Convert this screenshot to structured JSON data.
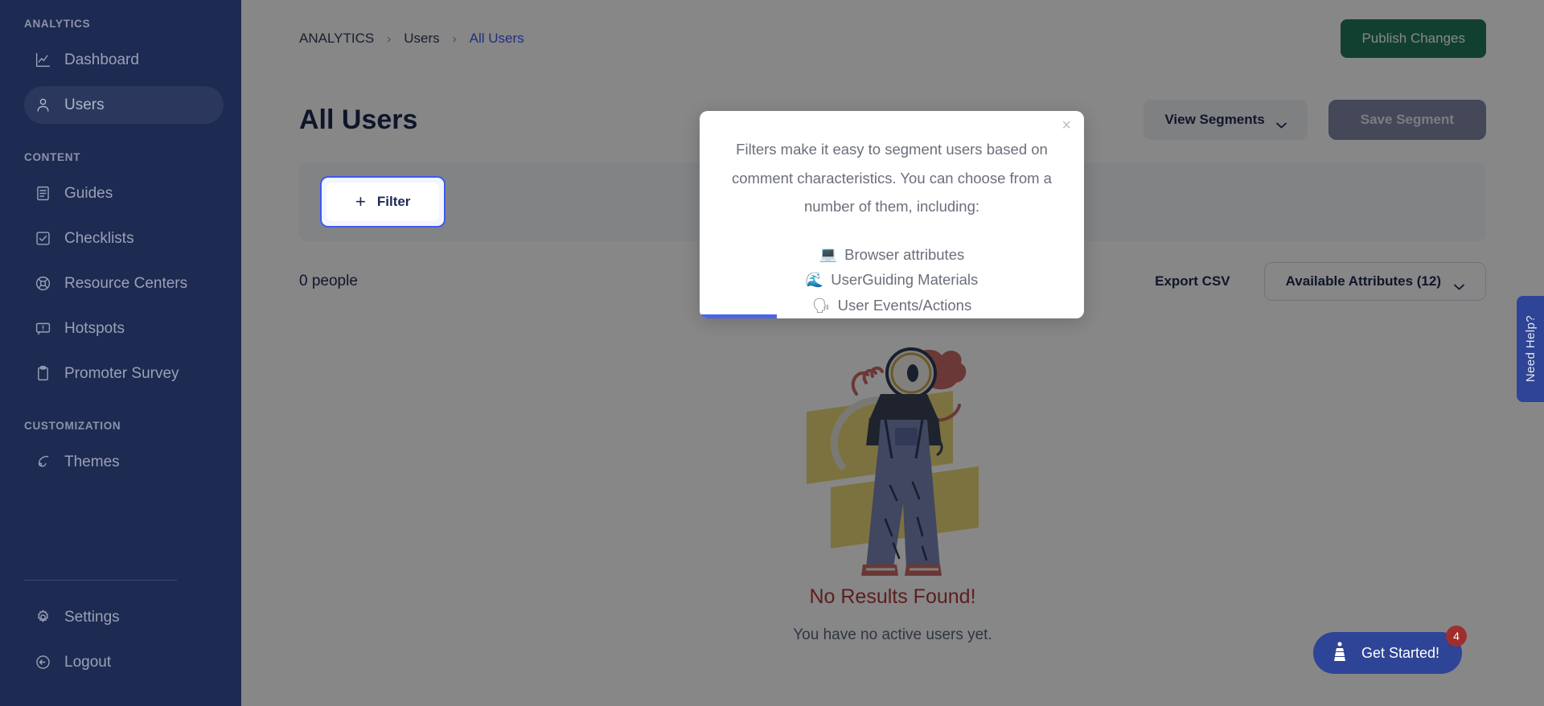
{
  "sidebar": {
    "sections": [
      {
        "title": "ANALYTICS",
        "items": [
          {
            "label": "Dashboard",
            "icon": "chart-line-icon",
            "active": false
          },
          {
            "label": "Users",
            "icon": "user-icon",
            "active": true
          }
        ]
      },
      {
        "title": "CONTENT",
        "items": [
          {
            "label": "Guides",
            "icon": "document-icon",
            "active": false
          },
          {
            "label": "Checklists",
            "icon": "checkbox-icon",
            "active": false
          },
          {
            "label": "Resource Centers",
            "icon": "lifebuoy-icon",
            "active": false
          },
          {
            "label": "Hotspots",
            "icon": "hotspot-icon",
            "active": false
          },
          {
            "label": "Promoter Survey",
            "icon": "clipboard-icon",
            "active": false
          }
        ]
      },
      {
        "title": "CUSTOMIZATION",
        "items": [
          {
            "label": "Themes",
            "icon": "paint-icon",
            "active": false
          }
        ]
      }
    ],
    "bottom": [
      {
        "label": "Settings",
        "icon": "gear-icon"
      },
      {
        "label": "Logout",
        "icon": "logout-icon"
      }
    ]
  },
  "topbar": {
    "breadcrumb": [
      {
        "label": "ANALYTICS",
        "current": false
      },
      {
        "label": "Users",
        "current": false
      },
      {
        "label": "All Users",
        "current": true
      }
    ],
    "separator": "›",
    "publish_label": "Publish Changes"
  },
  "page": {
    "title": "All Users",
    "view_segments_label": "View Segments",
    "save_segment_label": "Save Segment",
    "filter_label": "Filter",
    "filter_plus": "+",
    "people_count": "0 people",
    "export_csv_label": "Export CSV",
    "available_attributes_label": "Available Attributes (12)"
  },
  "empty_state": {
    "title": "No Results Found!",
    "subtitle": "You have no active users yet."
  },
  "tooltip": {
    "close_label": "×",
    "body": "Filters make it easy to segment users based on comment characteristics. You can choose from a number of them, including:",
    "items": [
      {
        "emoji": "💻",
        "icon": "laptop-emoji",
        "label": "Browser attributes"
      },
      {
        "emoji": "🌊",
        "icon": "userguiding-logo-emoji",
        "label": "UserGuiding Materials"
      },
      {
        "emoji": "🗣",
        "icon": "speaking-head-emoji",
        "label": "User Events/Actions"
      }
    ],
    "progress_percent": 20
  },
  "widgets": {
    "get_started_label": "Get Started!",
    "get_started_badge": "4",
    "need_help_label": "Need Help?"
  },
  "colors": {
    "sidebar_bg": "#1d2a52",
    "accent_blue": "#3d5af1",
    "publish_green": "#23795b",
    "error_red": "#b03a3a",
    "widget_blue": "#2e4496",
    "badge_red": "#a02e2e"
  }
}
